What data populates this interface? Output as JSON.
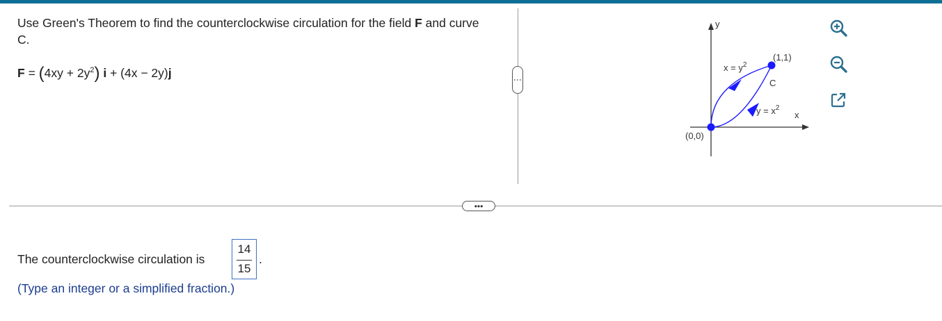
{
  "question": {
    "text_before": "Use Green's Theorem to find the counterclockwise circulation for the field ",
    "bold_field": "F",
    "text_after": " and curve C.",
    "formula": {
      "lhs": "F",
      "eq": " = ",
      "open_paren": "(",
      "inner": "4xy + 2y",
      "exp": "2",
      "close_paren": ")",
      "i": "i",
      "middle": " + (4x − 2y)",
      "j": "j"
    }
  },
  "graph": {
    "y_axis": "y",
    "x_axis": "x",
    "curve_top": "x = y",
    "curve_top_exp": "2",
    "curve_bottom": "y = x",
    "curve_bottom_exp": "2",
    "point_end": "(1,1)",
    "point_origin": "(0,0)",
    "curve_name": "C",
    "curve_color": "#1a1aff"
  },
  "handles": {
    "vertical": "⋮",
    "horizontal": "•••"
  },
  "answer": {
    "prefix": "The counterclockwise circulation is",
    "numerator": "14",
    "denominator": "15",
    "period": ".",
    "hint": "(Type an integer or a simplified fraction.)"
  },
  "toolbar": [
    "zoom-in-icon",
    "zoom-out-icon",
    "popout-icon"
  ],
  "colors": {
    "accent": "#0e6f94",
    "answer_border": "#3f6fc2",
    "hint": "#1b3c8f",
    "icon": "#2b6f8f"
  }
}
